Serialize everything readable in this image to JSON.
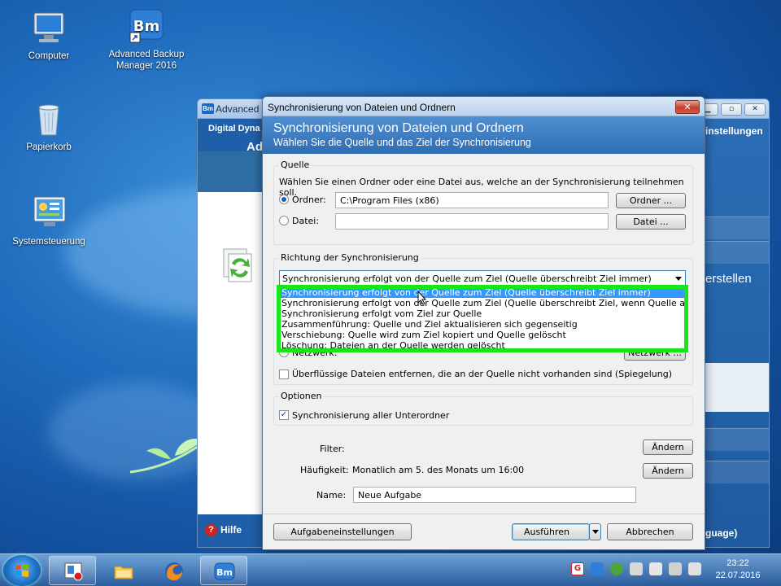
{
  "desktop": {
    "icons": [
      {
        "label": "Computer"
      },
      {
        "label": "Advanced Backup Manager 2016"
      },
      {
        "label": "Papierkorb"
      },
      {
        "label": "Systemsteuerung"
      }
    ]
  },
  "background_window": {
    "title": "Advanced",
    "left_header": "Digital Dyna",
    "left_header_big": "Ad",
    "help_label": "Hilfe",
    "right_items": [
      "instellungen",
      "erstellen",
      "guage)"
    ]
  },
  "dialog": {
    "title": "Synchronisierung von Dateien und Ordnern",
    "header_title": "Synchronisierung von Dateien und Ordnern",
    "header_subtitle": "Wählen Sie die Quelle und das Ziel der Synchronisierung",
    "source": {
      "legend": "Quelle",
      "instruction": "Wählen Sie einen Ordner oder eine Datei aus, welche an der Synchronisierung teilnehmen soll.",
      "folder_label": "Ordner:",
      "folder_value": "C:\\Program Files (x86)",
      "folder_button": "Ordner ...",
      "file_label": "Datei:",
      "file_value": "",
      "file_button": "Datei ..."
    },
    "direction": {
      "legend": "Richtung der Synchronisierung",
      "selected": "Synchronisierung erfolgt von der Quelle zum Ziel (Quelle überschreibt Ziel immer)",
      "options": [
        "Synchronisierung erfolgt von der Quelle zum Ziel (Quelle überschreibt Ziel immer)",
        "Synchronisierung erfolgt von der Quelle zum Ziel (Quelle überschreibt Ziel, wenn Quelle aktueller)",
        "Synchronisierung erfolgt vom Ziel zur Quelle",
        "Zusammenführung: Quelle und Ziel aktualisieren sich gegenseitig",
        "Verschiebung: Quelle wird zum Ziel kopiert und Quelle gelöscht",
        "Löschung: Dateien an der Quelle werden gelöscht"
      ],
      "network_label": "Netzwerk:",
      "network_button": "Netzwerk ...",
      "mirror_label": "Überflüssige Dateien entfernen, die an der Quelle nicht vorhanden sind (Spiegelung)"
    },
    "options": {
      "legend": "Optionen",
      "subfolders_label": "Synchronisierung aller Unterordner"
    },
    "filter_label": "Filter:",
    "filter_button": "Ändern",
    "frequency_label": "Häufigkeit:",
    "frequency_value": "Monatlich am 5. des Monats um 16:00",
    "frequency_button": "Ändern",
    "name_label": "Name:",
    "name_value": "Neue Aufgabe",
    "task_settings_button": "Aufgabeneinstellungen",
    "run_button": "Ausführen",
    "cancel_button": "Abbrechen"
  },
  "taskbar": {
    "time": "23:22",
    "date": "22.07.2016"
  },
  "colors": {
    "highlight": "#19e619",
    "selection": "#3399ff",
    "header_blue": "#2f6db3"
  }
}
